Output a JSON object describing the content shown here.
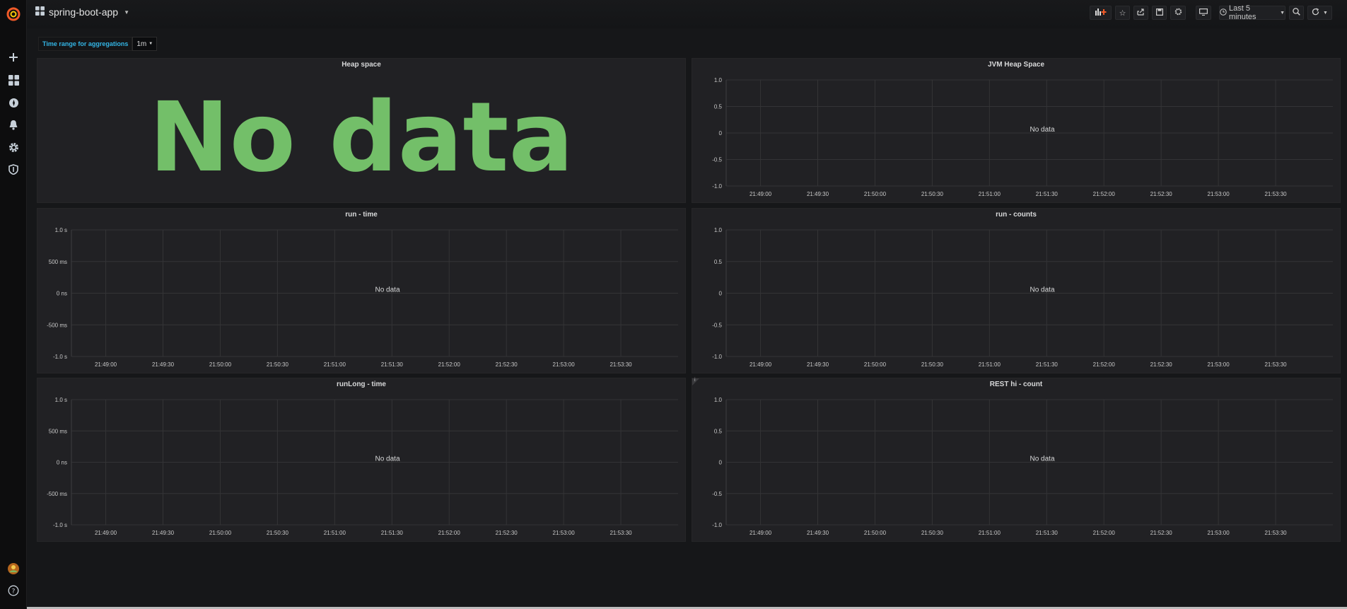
{
  "app": {
    "dashboard_title": "spring-boot-app",
    "time_range_label": "Last 5 minutes"
  },
  "sidebar": {
    "items": [
      {
        "icon": "grafana-logo-icon"
      },
      {
        "icon": "plus-icon"
      },
      {
        "icon": "dashboards-icon"
      },
      {
        "icon": "explore-compass-icon"
      },
      {
        "icon": "bell-icon"
      },
      {
        "icon": "gear-icon"
      },
      {
        "icon": "shield-icon"
      },
      {
        "icon": "user-avatar-icon"
      },
      {
        "icon": "help-icon"
      }
    ]
  },
  "toolbar": {
    "icons": [
      "add-panel-icon",
      "star-icon",
      "share-icon",
      "save-icon",
      "settings-icon",
      "tv-mode-icon",
      "clock-icon",
      "zoom-out-icon",
      "refresh-icon"
    ]
  },
  "variables": {
    "label": "Time range for aggregations",
    "value": "1m"
  },
  "panels": {
    "heap_space": {
      "title": "Heap space",
      "value": "No data"
    },
    "jvm_heap": {
      "title": "JVM Heap Space",
      "no_data": "No data"
    },
    "run_time": {
      "title": "run - time",
      "no_data": "No data"
    },
    "run_counts": {
      "title": "run - counts",
      "no_data": "No data"
    },
    "runlong_time": {
      "title": "runLong - time",
      "no_data": "No data"
    },
    "rest_hi": {
      "title": "REST hi - count",
      "no_data": "No data",
      "info_icon": "i"
    }
  },
  "chart_data": [
    {
      "type": "line",
      "title": "JVM Heap Space",
      "x": [
        "21:49:00",
        "21:49:30",
        "21:50:00",
        "21:50:30",
        "21:51:00",
        "21:51:30",
        "21:52:00",
        "21:52:30",
        "21:53:00",
        "21:53:30"
      ],
      "y_ticks": [
        "1.0",
        "0.5",
        "0",
        "-0.5",
        "-1.0"
      ],
      "ylim": [
        -1.0,
        1.0
      ],
      "series": [],
      "annotation": "No data",
      "grid": true
    },
    {
      "type": "line",
      "title": "run - time",
      "x": [
        "21:49:00",
        "21:49:30",
        "21:50:00",
        "21:50:30",
        "21:51:00",
        "21:51:30",
        "21:52:00",
        "21:52:30",
        "21:53:00",
        "21:53:30"
      ],
      "y_ticks": [
        "1.0 s",
        "500 ms",
        "0 ns",
        "-500 ms",
        "-1.0 s"
      ],
      "ylim": [
        -1.0,
        1.0
      ],
      "series": [],
      "annotation": "No data",
      "grid": true
    },
    {
      "type": "line",
      "title": "run - counts",
      "x": [
        "21:49:00",
        "21:49:30",
        "21:50:00",
        "21:50:30",
        "21:51:00",
        "21:51:30",
        "21:52:00",
        "21:52:30",
        "21:53:00",
        "21:53:30"
      ],
      "y_ticks": [
        "1.0",
        "0.5",
        "0",
        "-0.5",
        "-1.0"
      ],
      "ylim": [
        -1.0,
        1.0
      ],
      "series": [],
      "annotation": "No data",
      "grid": true
    },
    {
      "type": "line",
      "title": "runLong - time",
      "x": [
        "21:49:00",
        "21:49:30",
        "21:50:00",
        "21:50:30",
        "21:51:00",
        "21:51:30",
        "21:52:00",
        "21:52:30",
        "21:53:00",
        "21:53:30"
      ],
      "y_ticks": [
        "1.0 s",
        "500 ms",
        "0 ns",
        "-500 ms",
        "-1.0 s"
      ],
      "ylim": [
        -1.0,
        1.0
      ],
      "series": [],
      "annotation": "No data",
      "grid": true
    },
    {
      "type": "line",
      "title": "REST hi - count",
      "x": [
        "21:49:00",
        "21:49:30",
        "21:50:00",
        "21:50:30",
        "21:51:00",
        "21:51:30",
        "21:52:00",
        "21:52:30",
        "21:53:00",
        "21:53:30"
      ],
      "y_ticks": [
        "1.0",
        "0.5",
        "0",
        "-0.5",
        "-1.0"
      ],
      "ylim": [
        -1.0,
        1.0
      ],
      "series": [],
      "annotation": "No data",
      "grid": true
    }
  ],
  "colors": {
    "background": "#161719",
    "panel": "#212124",
    "stat_green": "#73bf69",
    "variable_label": "#33b5e5",
    "grid": "#3a3a3c",
    "logo_orange": "#f05a28"
  }
}
